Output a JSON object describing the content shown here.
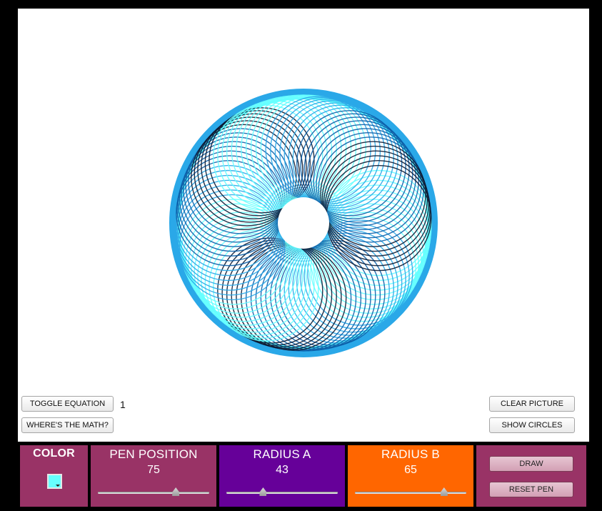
{
  "buttons": {
    "toggle_equation": "TOGGLE EQUATION",
    "wheres_the_math": "WHERE'S THE MATH?",
    "clear_picture": "CLEAR PICTURE",
    "show_circles": "SHOW CIRCLES",
    "draw": "DRAW",
    "reset_pen": "RESET PEN"
  },
  "equation_number": "1",
  "panels": {
    "color": {
      "title": "COLOR",
      "value": "#66ffff"
    },
    "pen_position": {
      "title": "PEN POSITION",
      "value": "75",
      "slider_fraction": 0.7
    },
    "radius_a": {
      "title": "RADIUS A",
      "value": "43",
      "slider_fraction": 0.33
    },
    "radius_b": {
      "title": "RADIUS B",
      "value": "65",
      "slider_fraction": 0.8
    }
  },
  "colors": {
    "spiro_light": "#66ffff",
    "spiro_mid": "#2aa8e8",
    "spiro_blue": "#0b5fa8",
    "spiro_dark": "#0a1a33",
    "color_panel": "#993366",
    "radius_a_panel": "#660099",
    "radius_b_panel": "#ff6600"
  }
}
